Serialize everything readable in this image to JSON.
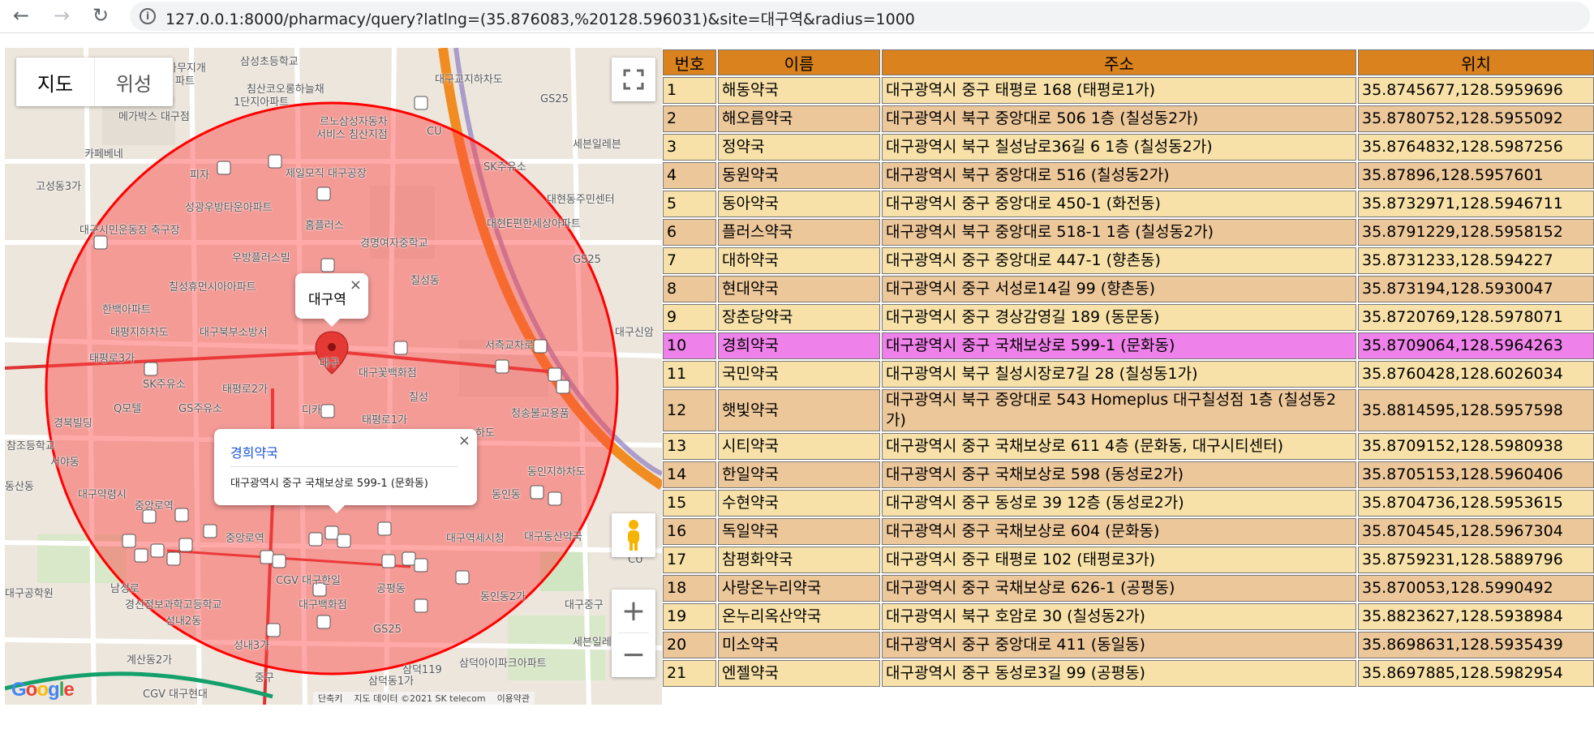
{
  "browser": {
    "back_icon": "arrow-left-icon",
    "forward_icon": "arrow-right-icon",
    "reload_icon": "reload-icon",
    "url": "127.0.0.1:8000/pharmacy/query?latlng=(35.876083,%20128.596031)&site=대구역&radius=1000"
  },
  "map": {
    "tabs": [
      "지도",
      "위성"
    ],
    "fullscreen_icon": "fullscreen-icon",
    "pegman_icon": "pegman-icon",
    "zoom_in": "+",
    "zoom_out": "−",
    "circle_color": "#ff0000",
    "marker_color": "#e53935",
    "station_infowindow": {
      "title": "대구역",
      "close": "×"
    },
    "shop_infowindow": {
      "name": "경희약국",
      "address": "대구광역시 중구 국채보상로 599-1 (문화동)",
      "close": "×"
    },
    "labels": [
      "삼성초등학교",
      "아무지개",
      "파트",
      "침산코오롱하늘채",
      "1단지아파트",
      "메가박스 대구점",
      "대구교지하차도",
      "GS25",
      "르노삼성자동차",
      "서비스 침산지점",
      "CU",
      "세븐일레븐",
      "카페베네",
      "피자",
      "제일모직 대구공장",
      "SK주유소",
      "고성동3가",
      "성광우방타운아파트",
      "대현동주민센터",
      "대구시민운동장 축구장",
      "홈플러스",
      "대현E편한세상아파트",
      "우방플러스빌",
      "경명여자중학교",
      "칠성휴먼시아아파트",
      "칠성동",
      "GS25",
      "한백아파트",
      "태평지하차도",
      "대구북부소방서",
      "대구",
      "서측교차로",
      "태평로3가",
      "대구꽃백화점",
      "대구신암",
      "SK주유소",
      "태평로2가",
      "칠성",
      "Q모텔",
      "GS주유소",
      "디카",
      "태평로1가",
      "청송불교용품",
      "경북빌딩",
      "참조등학교",
      "하도",
      "동인지하차도",
      "서야동",
      "중앙로역",
      "대구약령시",
      "동인동",
      "대구역세시청",
      "대구동산약국",
      "동산동",
      "중앙로역",
      "CGV 대구한일",
      "공평동",
      "대구백화점",
      "동인동2가",
      "경신정보과학고등학교",
      "남성로",
      "대구공학원",
      "성내2동",
      "계산동2가",
      "성내3가",
      "GS25",
      "삼덕119",
      "삼덕아이파크아파트",
      "세븐일레븐",
      "중구",
      "CGV 대구현대",
      "삼덕동1가",
      "대구중구",
      "CU"
    ],
    "footer": [
      "단축키",
      "지도 데이터 ©2021 SK telecom",
      "이용약관"
    ],
    "google_logo": "Google"
  },
  "table": {
    "headers": [
      "번호",
      "이름",
      "주소",
      "위치"
    ],
    "selected_row": 10,
    "rows": [
      {
        "no": "1",
        "name": "해동약국",
        "address": "대구광역시 중구 태평로 168 (태평로1가)",
        "pos": "35.8745677,128.5959696"
      },
      {
        "no": "2",
        "name": "해오름약국",
        "address": "대구광역시 북구 중앙대로 506 1층 (칠성동2가)",
        "pos": "35.8780752,128.5955092"
      },
      {
        "no": "3",
        "name": "정약국",
        "address": "대구광역시 북구 칠성남로36길 6 1층 (칠성동2가)",
        "pos": "35.8764832,128.5987256"
      },
      {
        "no": "4",
        "name": "동원약국",
        "address": "대구광역시 북구 중앙대로 516 (칠성동2가)",
        "pos": "35.87896,128.5957601"
      },
      {
        "no": "5",
        "name": "동아약국",
        "address": "대구광역시 중구 중앙대로 450-1 (화전동)",
        "pos": "35.8732971,128.5946711"
      },
      {
        "no": "6",
        "name": "플러스약국",
        "address": "대구광역시 북구 중앙대로 518-1 1층 (칠성동2가)",
        "pos": "35.8791229,128.5958152"
      },
      {
        "no": "7",
        "name": "대하약국",
        "address": "대구광역시 중구 중앙대로 447-1 (향촌동)",
        "pos": "35.8731233,128.594227"
      },
      {
        "no": "8",
        "name": "현대약국",
        "address": "대구광역시 중구 서성로14길 99 (향촌동)",
        "pos": "35.873194,128.5930047"
      },
      {
        "no": "9",
        "name": "장춘당약국",
        "address": "대구광역시 중구 경상감영길 189 (동문동)",
        "pos": "35.8720769,128.5978071"
      },
      {
        "no": "10",
        "name": "경희약국",
        "address": "대구광역시 중구 국채보상로 599-1 (문화동)",
        "pos": "35.8709064,128.5964263"
      },
      {
        "no": "11",
        "name": "국민약국",
        "address": "대구광역시 북구 칠성시장로7길 28 (칠성동1가)",
        "pos": "35.8760428,128.6026034"
      },
      {
        "no": "12",
        "name": "햇빛약국",
        "address": "대구광역시 북구 중앙대로 543 Homeplus 대구칠성점 1층 (칠성동2가)",
        "pos": "35.8814595,128.5957598"
      },
      {
        "no": "13",
        "name": "시티약국",
        "address": "대구광역시 중구 국채보상로 611 4층 (문화동, 대구시티센터)",
        "pos": "35.8709152,128.5980938"
      },
      {
        "no": "14",
        "name": "한일약국",
        "address": "대구광역시 중구 국채보상로 598 (동성로2가)",
        "pos": "35.8705153,128.5960406"
      },
      {
        "no": "15",
        "name": "수현약국",
        "address": "대구광역시 중구 동성로 39 12층 (동성로2가)",
        "pos": "35.8704736,128.5953615"
      },
      {
        "no": "16",
        "name": "독일약국",
        "address": "대구광역시 중구 국채보상로 604 (문화동)",
        "pos": "35.8704545,128.5967304"
      },
      {
        "no": "17",
        "name": "참평화약국",
        "address": "대구광역시 중구 태평로 102 (태평로3가)",
        "pos": "35.8759231,128.5889796"
      },
      {
        "no": "18",
        "name": "사랑온누리약국",
        "address": "대구광역시 중구 국채보상로 626-1 (공평동)",
        "pos": "35.870053,128.5990492"
      },
      {
        "no": "19",
        "name": "온누리옥산약국",
        "address": "대구광역시 북구 호암로 30 (칠성동2가)",
        "pos": "35.8823627,128.5938984"
      },
      {
        "no": "20",
        "name": "미소약국",
        "address": "대구광역시 중구 중앙대로 411 (동일동)",
        "pos": "35.8698631,128.5935439"
      },
      {
        "no": "21",
        "name": "엔젤약국",
        "address": "대구광역시 중구 동성로3길 99 (공평동)",
        "pos": "35.8697885,128.5982954"
      }
    ]
  }
}
